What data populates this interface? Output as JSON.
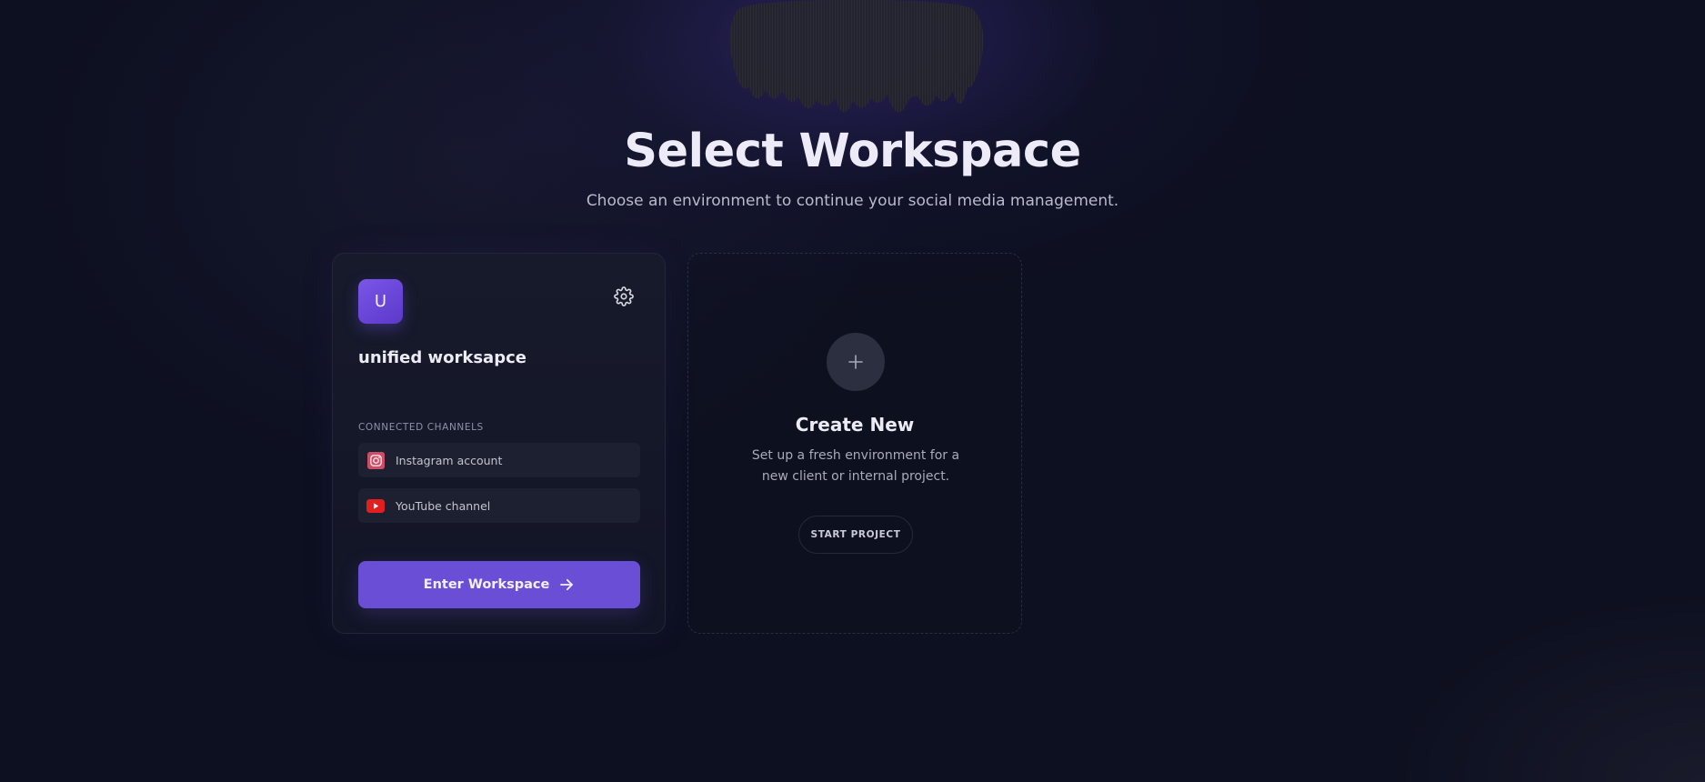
{
  "header": {
    "title": "Select Workspace",
    "subtitle": "Choose an environment to continue your social media management."
  },
  "workspace": {
    "avatar_letter": "U",
    "name": "unified worksapce",
    "channels_label": "CONNECTED CHANNELS",
    "channels": [
      {
        "label": "Instagram account",
        "icon": "instagram-icon"
      },
      {
        "label": "YouTube channel",
        "icon": "youtube-icon"
      }
    ],
    "enter_label": "Enter Workspace",
    "settings_icon": "gear-icon"
  },
  "create_new": {
    "title": "Create New",
    "description": "Set up a fresh environment for a new client or internal project.",
    "button_label": "START PROJECT",
    "icon": "plus-icon"
  },
  "colors": {
    "background": "#0d1020",
    "accent": "#6a4fd6",
    "card": "#171a2b",
    "instagram": "#d9576b",
    "youtube": "#e02020"
  }
}
